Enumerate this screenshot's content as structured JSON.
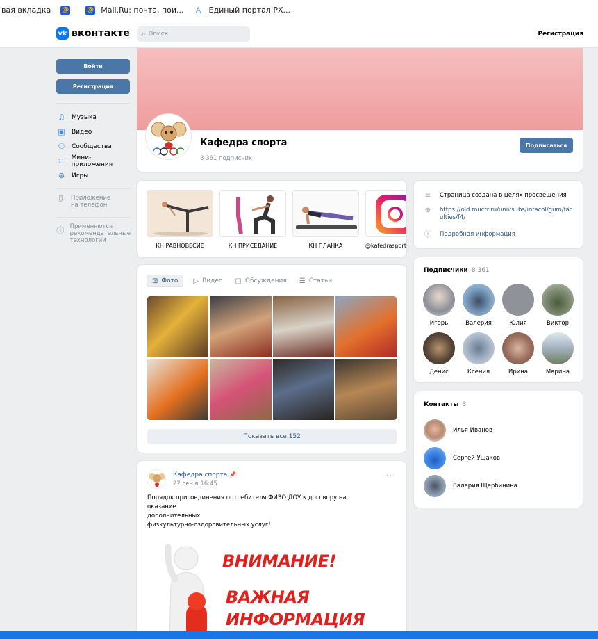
{
  "bookmarks": [
    {
      "label": "вая вкладка",
      "icon": "none"
    },
    {
      "label": "",
      "icon": "mail-icon"
    },
    {
      "label": "Mail.Ru: почта, пои...",
      "icon": "mail-icon"
    },
    {
      "label": "Единый портал РХ...",
      "icon": "portal-icon"
    }
  ],
  "header": {
    "logo_text": "вконтакте",
    "search_placeholder": "Поиск",
    "register_link": "Регистрация"
  },
  "left_nav": {
    "login_button": "Войти",
    "register_button": "Регистрация",
    "items": [
      {
        "label": "Музыка",
        "icon": "music-icon"
      },
      {
        "label": "Видео",
        "icon": "video-icon"
      },
      {
        "label": "Сообщества",
        "icon": "communities-icon"
      },
      {
        "label": "Мини-приложения",
        "icon": "apps-icon"
      },
      {
        "label": "Игры",
        "icon": "games-icon"
      }
    ],
    "app_line1": "Приложение",
    "app_line2": "на телефон",
    "rec_line1": "Применяются",
    "rec_line2": "рекомендательные",
    "rec_line3": "технологии"
  },
  "profile": {
    "name": "Кафедра спорта",
    "subscribers": "8 361 подписчик",
    "subscribe_button": "Подписаться"
  },
  "products": [
    {
      "label": "КН РАВНОВЕСИЕ"
    },
    {
      "label": "КН ПРИСЕДАНИЕ"
    },
    {
      "label": "КН ПЛАНКА"
    },
    {
      "label": "@kafedrasport"
    }
  ],
  "info": {
    "description": "Страница создана в целях просвещения",
    "url_line1": "https://old.muctr.ru/univsubs/infacol/gum/fac",
    "url_line2": "ulties/f4/",
    "details_link": "Подробная информация"
  },
  "media": {
    "tabs": [
      "Фото",
      "Видео",
      "Обсуждения",
      "Статьи"
    ],
    "show_all": "Показать все 152"
  },
  "subscribers_block": {
    "title": "Подписчики",
    "count": "8 361",
    "people": [
      "Игорь",
      "Валерия",
      "Юлия",
      "Виктор",
      "Денис",
      "Ксения",
      "Ирина",
      "Марина"
    ]
  },
  "contacts_block": {
    "title": "Контакты",
    "count": "3",
    "people": [
      "Илья Иванов",
      "Сергей Ушаков",
      "Валерия Щербинина"
    ]
  },
  "post": {
    "author": "Кафедра спорта",
    "pin": "📌",
    "date": "27 сен в 16:45",
    "menu": "···",
    "text_line1": "Порядок присоединения потребителя ФИЗО ДОУ к договору на оказание",
    "text_line2": "дополнительных",
    "text_line3": "физкультурно-оздоровительных услуг!",
    "banner_line1": "ВНИМАНИЕ!",
    "banner_line2": "ВАЖНАЯ",
    "banner_line3": "ИНФОРМАЦИЯ"
  },
  "colors": {
    "brand": "#0077ff",
    "button": "#4a76a8",
    "link": "#2a5885",
    "cover": "#ef9d9d",
    "banner_red": "#e0201c"
  }
}
